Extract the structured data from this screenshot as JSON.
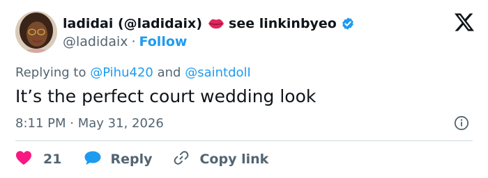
{
  "author": {
    "display_name": "ladidai (@ladidaix)",
    "name_suffix": "see linkinbyeo",
    "handle": "@ladidaix",
    "separator": "·",
    "follow_label": "Follow",
    "verified_color": "#1d9bf0",
    "lips_color": "#e0245e"
  },
  "tweet": {
    "replying_prefix": "Replying to",
    "replying_to": [
      "@Pihu420",
      "@saintdolI"
    ],
    "replying_conjunction": "and",
    "text": "It’s the perfect court wedding look",
    "time": "8:11 PM",
    "date_separator": "·",
    "date": "May 31, 2026"
  },
  "actions": {
    "likes": "21",
    "reply_label": "Reply",
    "copy_label": "Copy link"
  },
  "colors": {
    "accent": "#1d9bf0",
    "like": "#f91880",
    "secondary_text": "#536471",
    "divider": "#cfd9de"
  },
  "icons": {
    "platform": "x-logo-icon",
    "like": "heart-icon",
    "reply": "speech-bubble-icon",
    "copy": "link-icon",
    "info": "info-icon"
  }
}
